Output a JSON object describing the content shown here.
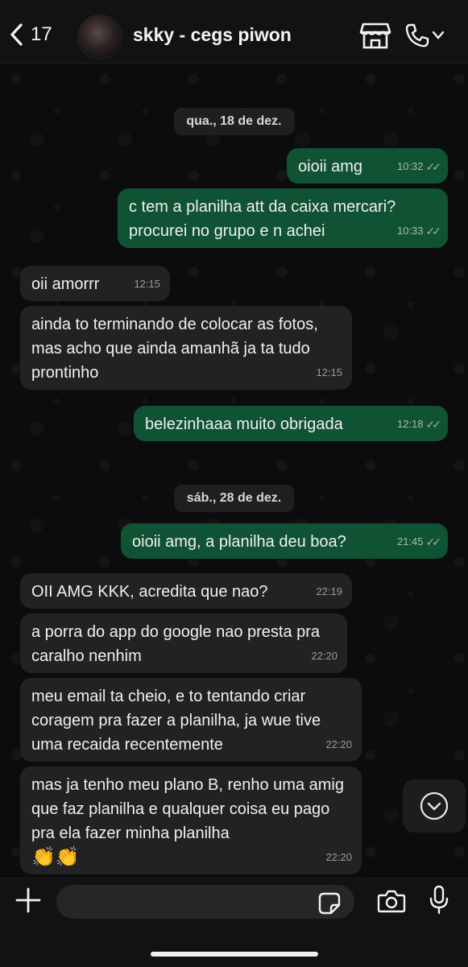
{
  "header": {
    "back_count": "17",
    "contact_name": "skky - cegs piwon",
    "icons": [
      "chevron-left-icon",
      "store-icon",
      "phone-icon",
      "chevron-down-icon"
    ]
  },
  "dates": [
    "qua., 18 de dez.",
    "sáb., 28 de dez."
  ],
  "messages": [
    {
      "dir": "out",
      "text": "oioii amg",
      "time": "10:32",
      "read": true
    },
    {
      "dir": "out",
      "text": "c tem a planilha att da caixa mercari? procurei no grupo e n achei",
      "time": "10:33",
      "read": true
    },
    {
      "dir": "in",
      "text": "oii amorrr",
      "time": "12:15"
    },
    {
      "dir": "in",
      "text": "ainda to terminando de colocar as fotos, mas acho que ainda amanhã ja ta tudo prontinho",
      "time": "12:15"
    },
    {
      "dir": "out",
      "text": "belezinhaaa muito obrigada",
      "time": "12:18",
      "read": true
    },
    {
      "dir": "out",
      "text": "oioii amg, a planilha deu boa?",
      "time": "21:45",
      "read": true
    },
    {
      "dir": "in",
      "text": "OII AMG KKK, acredita que nao?",
      "time": "22:19"
    },
    {
      "dir": "in",
      "text": "a porra do app do google nao presta pra caralho nenhim",
      "time": "22:20"
    },
    {
      "dir": "in",
      "text": "meu email ta cheio, e to tentando criar coragem pra fazer a planilha, ja wue tive uma recaida recentemente",
      "time": "22:20"
    },
    {
      "dir": "in",
      "text": "mas ja tenho meu plano B, renho uma amig que faz planilha e qualquer coisa eu pago pra ela fazer minha planilha",
      "emoji": "👏👏",
      "time": "22:20"
    }
  ],
  "composer": {
    "placeholder": ""
  },
  "colors": {
    "outgoing": "#0f5234",
    "incoming": "#222222",
    "background": "#0b0b0b"
  }
}
